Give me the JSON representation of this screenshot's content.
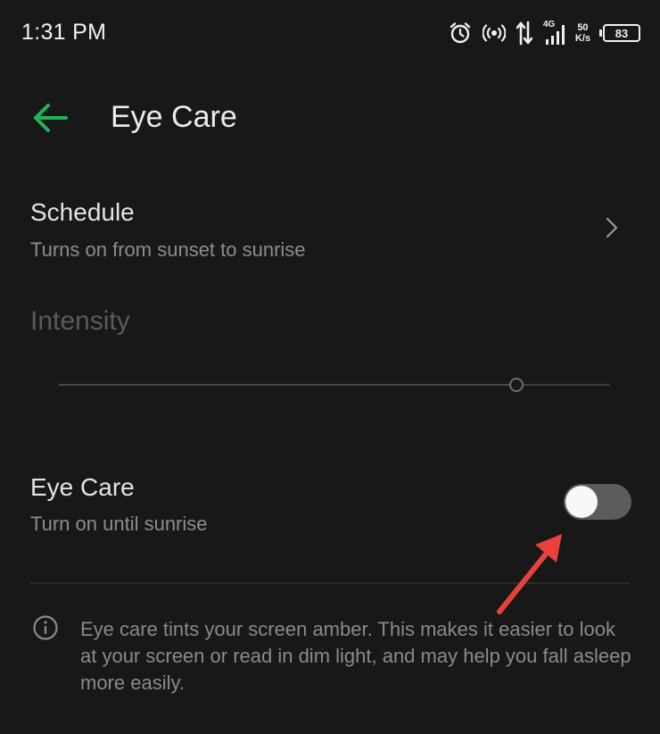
{
  "status_bar": {
    "time": "1:31 PM",
    "network": "4G",
    "speed_value": "50",
    "speed_unit": "K/s",
    "battery": "83",
    "icons": [
      "alarm-icon",
      "hotspot-icon",
      "data-transfer-icon",
      "signal-icon",
      "battery-icon"
    ]
  },
  "app_bar": {
    "title": "Eye Care",
    "back_icon": "back-arrow-icon"
  },
  "schedule": {
    "title": "Schedule",
    "subtitle": "Turns on from sunset to sunrise",
    "icon": "chevron-right-icon"
  },
  "intensity": {
    "label": "Intensity",
    "value": 0.83,
    "enabled": false
  },
  "eye_care_toggle": {
    "title": "Eye Care",
    "subtitle": "Turn on until sunrise",
    "checked": false
  },
  "info": {
    "icon": "info-icon",
    "text": "Eye care tints your screen amber. This makes it easier to look at your screen or read in dim light, and may help you fall asleep more easily."
  },
  "colors": {
    "background": "#181818",
    "accent": "#1fb355",
    "annotation": "#e8413c"
  }
}
